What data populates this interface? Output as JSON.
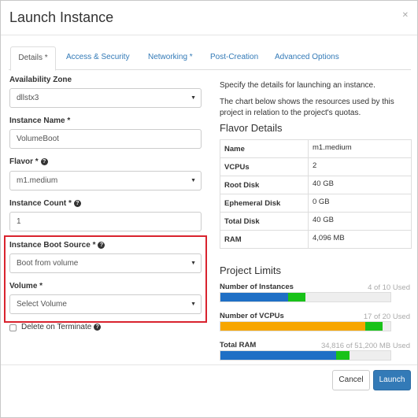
{
  "modal": {
    "title": "Launch Instance",
    "close_icon": "close-icon"
  },
  "tabs": [
    {
      "label": "Details *",
      "active": true
    },
    {
      "label": "Access & Security",
      "active": false
    },
    {
      "label": "Networking *",
      "active": false
    },
    {
      "label": "Post-Creation",
      "active": false
    },
    {
      "label": "Advanced Options",
      "active": false
    }
  ],
  "form": {
    "availability_zone": {
      "label": "Availability Zone",
      "value": "dllstx3"
    },
    "instance_name": {
      "label": "Instance Name *",
      "value": "VolumeBoot"
    },
    "flavor": {
      "label": "Flavor *",
      "value": "m1.medium"
    },
    "instance_count": {
      "label": "Instance Count *",
      "value": "1"
    },
    "boot_source": {
      "label": "Instance Boot Source *",
      "value": "Boot from volume"
    },
    "volume": {
      "label": "Volume *",
      "value": "Select Volume"
    },
    "delete_on_terminate": {
      "label": "Delete on Terminate",
      "checked": false
    }
  },
  "info": {
    "line1": "Specify the details for launching an instance.",
    "line2": "The chart below shows the resources used by this project in relation to the project's quotas."
  },
  "flavor_details": {
    "title": "Flavor Details",
    "rows": [
      {
        "key": "Name",
        "value": "m1.medium"
      },
      {
        "key": "VCPUs",
        "value": "2"
      },
      {
        "key": "Root Disk",
        "value": "40 GB"
      },
      {
        "key": "Ephemeral Disk",
        "value": "0 GB"
      },
      {
        "key": "Total Disk",
        "value": "40 GB"
      },
      {
        "key": "RAM",
        "value": "4,096 MB"
      }
    ]
  },
  "project_limits": {
    "title": "Project Limits",
    "items": [
      {
        "label": "Number of Instances",
        "used_text": "4 of 10 Used",
        "used_fraction": 0.4,
        "added_fraction": 0.1,
        "used_color": "#1f6fc5"
      },
      {
        "label": "Number of VCPUs",
        "used_text": "17 of 20 Used",
        "used_fraction": 0.85,
        "added_fraction": 0.1,
        "used_color": "#f7a600"
      },
      {
        "label": "Total RAM",
        "used_text": "34,816 of 51,200 MB Used",
        "used_fraction": 0.68,
        "added_fraction": 0.08,
        "used_color": "#1f6fc5"
      }
    ],
    "added_color": "#19c219"
  },
  "footer": {
    "cancel_label": "Cancel",
    "launch_label": "Launch"
  },
  "colors": {
    "accent": "#337ab7",
    "highlight": "#d9232e"
  }
}
